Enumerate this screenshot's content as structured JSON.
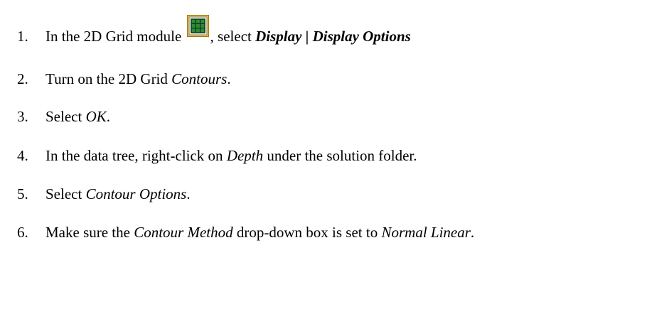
{
  "steps": [
    {
      "number": "1.",
      "parts": {
        "a": "In the 2D Grid module ",
        "b": ", select ",
        "c": "Display",
        "d": " | ",
        "e": "Display Options"
      },
      "icon": "2d-grid-module-icon"
    },
    {
      "number": "2.",
      "parts": {
        "a": "Turn on the 2D Grid ",
        "b": "Contours",
        "c": "."
      }
    },
    {
      "number": "3.",
      "parts": {
        "a": "Select ",
        "b": "OK",
        "c": "."
      }
    },
    {
      "number": "4.",
      "parts": {
        "a": "In the data tree, right-click on ",
        "b": "Depth",
        "c": " under the solution folder."
      }
    },
    {
      "number": "5.",
      "parts": {
        "a": "Select ",
        "b": "Contour Options",
        "c": "."
      }
    },
    {
      "number": "6.",
      "parts": {
        "a": "Make sure the ",
        "b": "Contour Method",
        "c": " drop-down box is set to ",
        "d": "Normal Linear",
        "e": "."
      }
    }
  ],
  "colors": {
    "icon_frame_yellow": "#f2c230",
    "icon_grid_green": "#2f8a3a",
    "icon_grid_line": "#0a3a10"
  }
}
